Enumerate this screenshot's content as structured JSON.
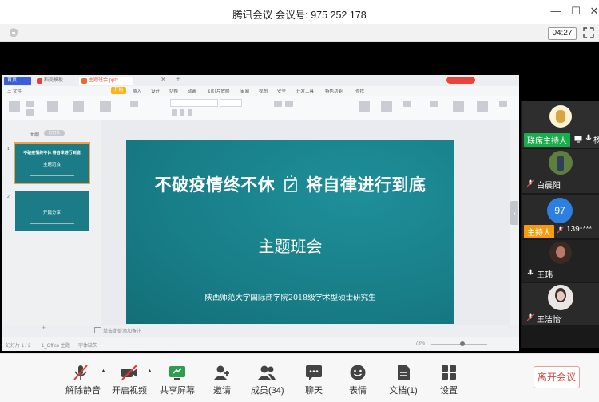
{
  "window": {
    "title": "腾讯会议 会议号: 975 252 178",
    "timer": "04:27"
  },
  "wps": {
    "tabs": [
      "首页",
      "稻壳模板",
      "主题班会.pptx"
    ],
    "menu": [
      "三 文件",
      "开始",
      "插入",
      "设计",
      "切换",
      "动画",
      "幻灯片放映",
      "审阅",
      "视图",
      "安全",
      "开发工具",
      "特色功能",
      "查找"
    ],
    "active_menu": "开始",
    "pane_tabs": [
      "大纲",
      "幻灯片"
    ],
    "thumb1_title": "不破疫情终不休 将自律进行到底",
    "thumb1_sub": "主题班会",
    "thumb2_title": "开篇分享",
    "notes_placeholder": "单击此处添加备注",
    "status": [
      "幻灯片 1 / 2",
      "1_Office 主题",
      "字体缺失"
    ],
    "zoom": "73%"
  },
  "slide": {
    "title_left": "不破疫情终不休",
    "title_right": "将自律进行到底",
    "subtitle": "主题班会",
    "footer": "陕西师范大学国际商学院2018级学术型硕士研究生"
  },
  "participants": [
    {
      "name": "联席主持人",
      "role_badge": true,
      "badge_color": "#1aad4b",
      "partial_name": "杨"
    },
    {
      "name": "白晨阳"
    },
    {
      "name": "139****",
      "avatar_text": "97",
      "badge": "主持人",
      "badge_color": "#f39c12"
    },
    {
      "name": "王玮"
    },
    {
      "name": "王洁怡"
    }
  ],
  "toolbar": {
    "mute": "解除静音",
    "video": "开启视频",
    "share": "共享屏幕",
    "invite": "邀请",
    "members": "成员(34)",
    "chat": "聊天",
    "reactions": "表情",
    "docs": "文档(1)",
    "settings": "设置",
    "leave": "离开会议"
  },
  "colors": {
    "slide_bg": "#187d87",
    "leave_text": "#d8473c",
    "host_badge": "#f39c12",
    "cohost_badge": "#1aad4b"
  }
}
